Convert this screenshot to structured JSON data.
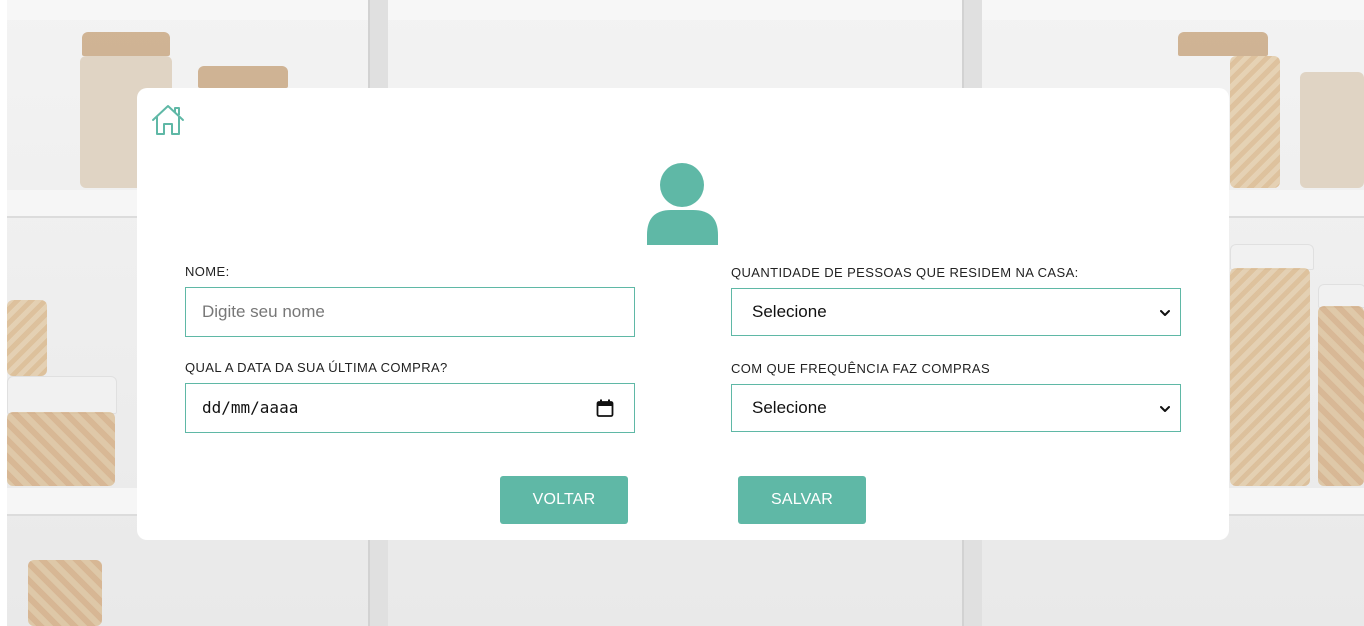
{
  "form": {
    "name_label": "NOME:",
    "name_placeholder": "Digite seu nome",
    "date_label": "QUAL A DATA DA SUA ÚLTIMA COMPRA?",
    "date_placeholder": "dd/mm/aaaa",
    "people_label": "QUANTIDADE DE PESSOAS QUE RESIDEM NA CASA:",
    "people_selected": "Selecione",
    "frequency_label": "COM QUE FREQUÊNCIA FAZ COMPRAS",
    "frequency_selected": "Selecione"
  },
  "actions": {
    "back_label": "VOLTAR",
    "save_label": "SALVAR"
  },
  "colors": {
    "accent": "#5fb8a6",
    "card_bg": "#ffffff",
    "text": "#222222"
  },
  "icons": {
    "home": "home-icon",
    "avatar": "user-avatar-icon",
    "calendar": "calendar-icon",
    "select_arrow": "chevron-down-icon"
  }
}
